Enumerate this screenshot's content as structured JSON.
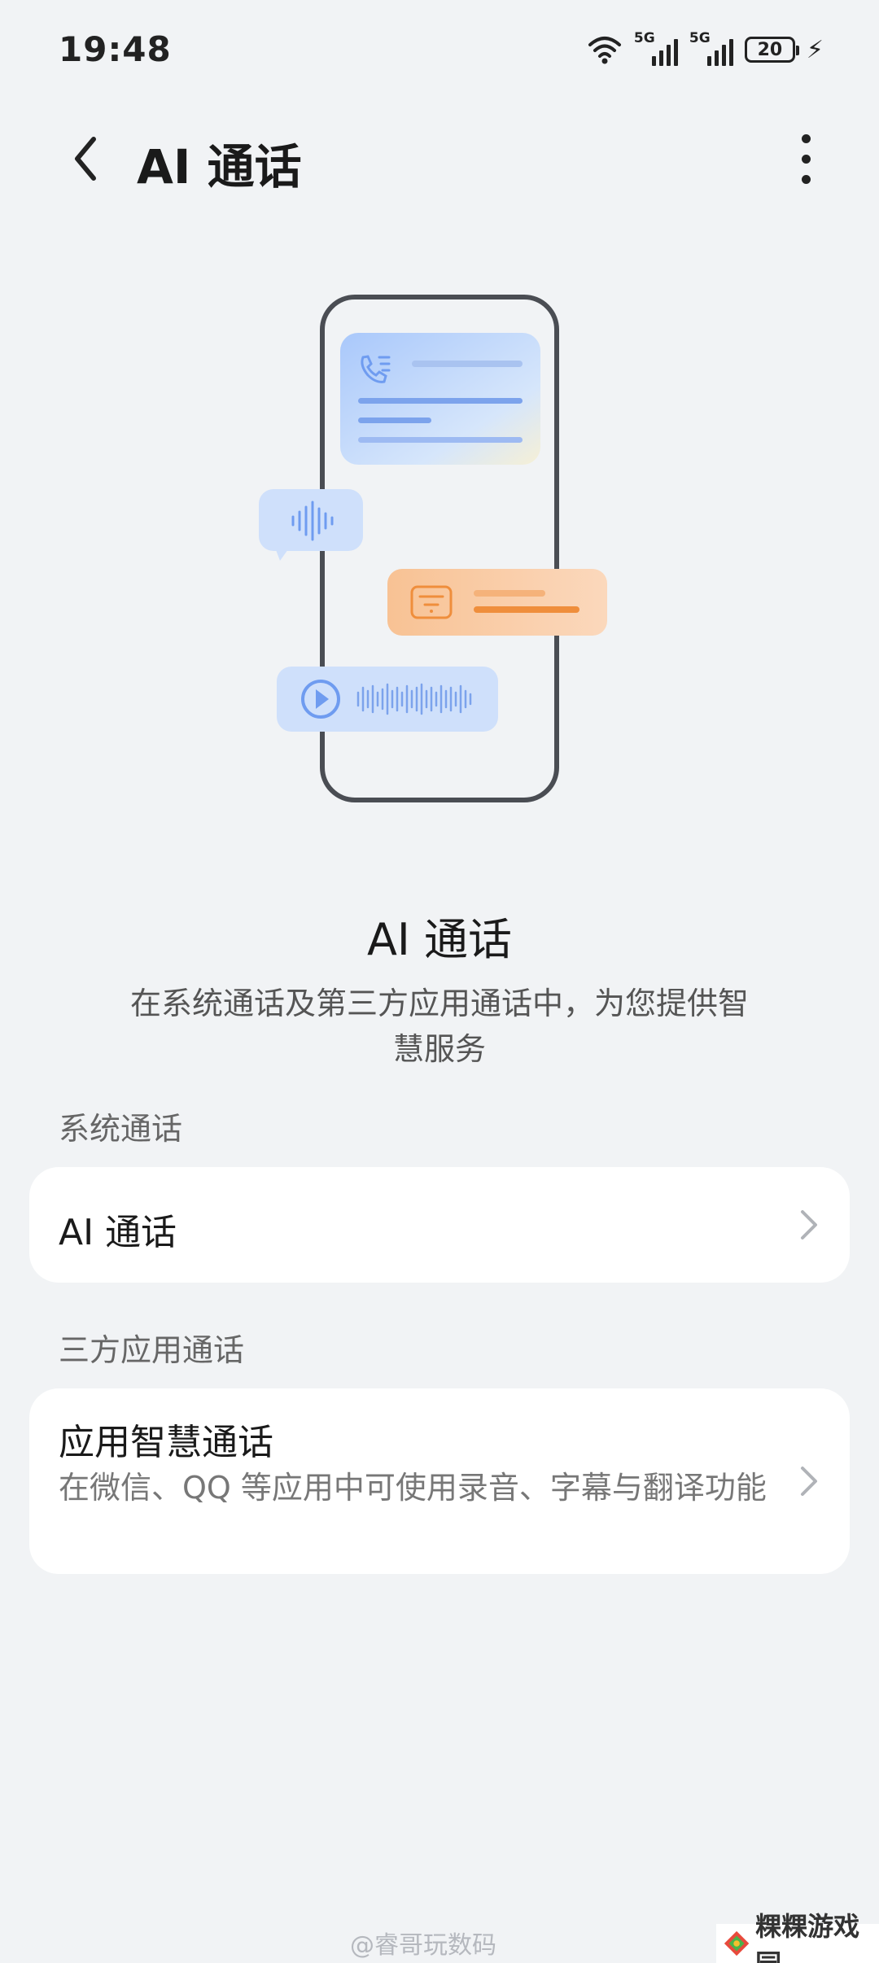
{
  "status_bar": {
    "time": "19:48",
    "network_1": "5G",
    "network_2": "5G",
    "battery": "20",
    "icons": [
      "wifi-icon",
      "signal-icon",
      "signal-icon",
      "battery-icon",
      "charging-icon"
    ]
  },
  "header": {
    "title": "AI 通话",
    "back_icon": "chevron-left-icon",
    "more_icon": "more-vertical-icon"
  },
  "intro": {
    "title": "AI 通话",
    "description": "在系统通话及第三方应用通话中，为您提供智慧服务"
  },
  "sections": [
    {
      "label": "系统通话",
      "items": [
        {
          "title": "AI 通话",
          "icon": "chevron-right-icon"
        }
      ]
    },
    {
      "label": "三方应用通话",
      "items": [
        {
          "title": "应用智慧通话",
          "subtitle": "在微信、QQ 等应用中可使用录音、字幕与翻译功能",
          "icon": "chevron-right-icon"
        }
      ]
    }
  ],
  "watermark": "@睿哥玩数码",
  "brand": "粿粿游戏园",
  "colors": {
    "background": "#f1f3f5",
    "card": "#ffffff",
    "accent_blue": "#6f9cf0",
    "accent_orange": "#f5a256"
  }
}
